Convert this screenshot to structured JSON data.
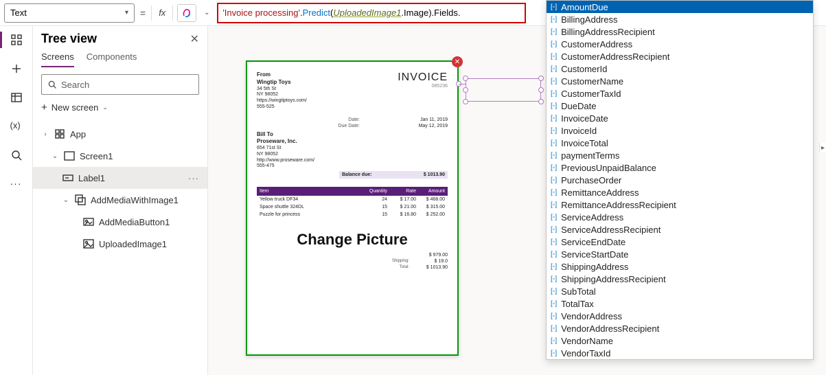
{
  "propertySelector": {
    "value": "Text"
  },
  "formula": {
    "string": "'Invoice processing'",
    "method": "Predict",
    "identifier": "UploadedImage1",
    "identProp": "Image",
    "tailProp": "Fields"
  },
  "treeView": {
    "title": "Tree view",
    "tabs": {
      "screens": "Screens",
      "components": "Components"
    },
    "searchPlaceholder": "Search",
    "newScreen": "New screen",
    "nodes": {
      "app": "App",
      "screen1": "Screen1",
      "label1": "Label1",
      "addMedia": "AddMediaWithImage1",
      "addMediaButton": "AddMediaButton1",
      "uploadedImage": "UploadedImage1"
    }
  },
  "invoice": {
    "fromHeader": "From",
    "fromName": "Wingtip Toys",
    "fromAddr1": "34 5th St",
    "fromAddr2": "NY 98052",
    "fromSite": "https://wingtiptoys.com/",
    "fromPhone": "555-525",
    "title": "INVOICE",
    "number": "085236",
    "dateLabel": "Date:",
    "dateValue": "Jan 11, 2019",
    "dueLabel": "Due Date:",
    "dueValue": "May 12, 2019",
    "billToHeader": "Bill To",
    "billToName": "Proseware, Inc.",
    "billToAddr1": "654 71st St",
    "billToAddr2": "NY 98052",
    "billToSite": "http://www.proseware.com/",
    "billToPhone": "555-475",
    "balanceLabel": "Balance due:",
    "balanceValue": "$ 1013.90",
    "headers": {
      "item": "Item",
      "qty": "Quantity",
      "rate": "Rate",
      "amount": "Amount"
    },
    "rows": [
      {
        "item": "Yellow truck DF34",
        "qty": "24",
        "rate": "$ 17.00",
        "amount": "$ 468.00"
      },
      {
        "item": "Space shuttle 324DL",
        "qty": "15",
        "rate": "$ 21.00",
        "amount": "$ 315.00"
      },
      {
        "item": "Puzzle for princess",
        "qty": "15",
        "rate": "$ 16.80",
        "amount": "$ 252.00"
      }
    ],
    "changePicture": "Change Picture",
    "totals": {
      "subLabel": "",
      "subValue": "$ 979.00",
      "shipLabel": "Shipping:",
      "shipValue": "$ 19.0",
      "totalLabel": "Total:",
      "totalValue": "$ 1013.90"
    }
  },
  "autocomplete": {
    "items": [
      "AmountDue",
      "BillingAddress",
      "BillingAddressRecipient",
      "CustomerAddress",
      "CustomerAddressRecipient",
      "CustomerId",
      "CustomerName",
      "CustomerTaxId",
      "DueDate",
      "InvoiceDate",
      "InvoiceId",
      "InvoiceTotal",
      "paymentTerms",
      "PreviousUnpaidBalance",
      "PurchaseOrder",
      "RemittanceAddress",
      "RemittanceAddressRecipient",
      "ServiceAddress",
      "ServiceAddressRecipient",
      "ServiceEndDate",
      "ServiceStartDate",
      "ShippingAddress",
      "ShippingAddressRecipient",
      "SubTotal",
      "TotalTax",
      "VendorAddress",
      "VendorAddressRecipient",
      "VendorName",
      "VendorTaxId"
    ],
    "selectedIndex": 0
  }
}
